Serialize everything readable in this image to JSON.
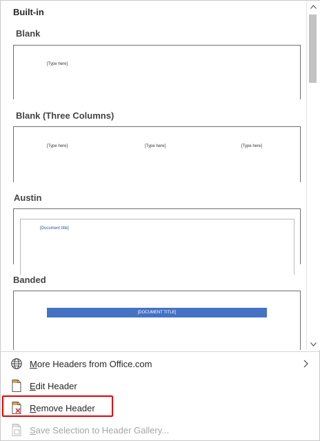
{
  "gallery": {
    "section_title": "Built-in",
    "items": [
      {
        "title": "Blank",
        "placeholders": [
          "[Type here]"
        ]
      },
      {
        "title": "Blank (Three Columns)",
        "placeholders": [
          "[Type here]",
          "[Type here]",
          "[Type here]"
        ]
      },
      {
        "title": "Austin",
        "placeholders": [
          "[Document title]"
        ]
      },
      {
        "title": "Banded",
        "placeholders": [
          "[DOCUMENT TITLE]"
        ]
      }
    ]
  },
  "menu": {
    "more_headers": {
      "label": "More Headers from Office.com",
      "access_key": "M",
      "rest": "ore Headers from Office.com"
    },
    "edit_header": {
      "label": "Edit Header",
      "access_key": "E",
      "rest": "dit Header"
    },
    "remove_header": {
      "label": "Remove Header",
      "access_key": "R",
      "rest": "emove Header"
    },
    "save_selection": {
      "label": "Save Selection to Header Gallery...",
      "access_key": "S",
      "rest": "ave Selection to Header Gallery..."
    }
  },
  "colors": {
    "accent_blue": "#4472c4",
    "highlight_red": "#e30000",
    "disabled_text": "#a6a6a6"
  }
}
